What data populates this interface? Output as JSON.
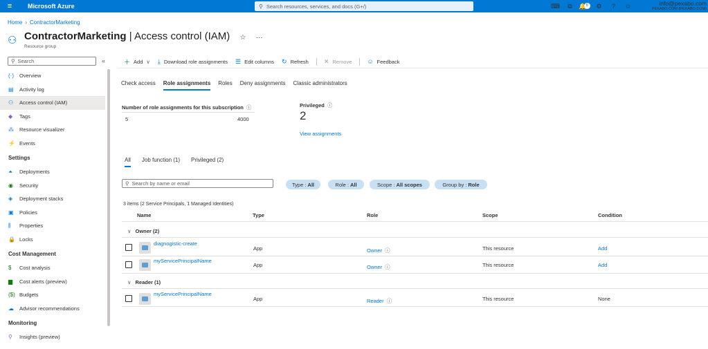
{
  "topbar": {
    "brand": "Microsoft Azure",
    "search_placeholder": "Search resources, services, and docs (G+/)",
    "notification_count": "6",
    "account_email": "info@pexabo.com",
    "account_org": "PEXABO.COM (PEXABO.COM)"
  },
  "breadcrumb": {
    "home": "Home",
    "current": "ContractorMarketing"
  },
  "page": {
    "resource": "ContractorMarketing",
    "separator": " | ",
    "section": "Access control (IAM)",
    "subtitle": "Resource group",
    "star": "☆",
    "more": "···"
  },
  "sidebar": {
    "search_placeholder": "Search",
    "items": [
      {
        "label": "Overview",
        "icon": "(·)",
        "color": "#0078d4"
      },
      {
        "label": "Activity log",
        "icon": "▤",
        "color": "#0078d4"
      },
      {
        "label": "Access control (IAM)",
        "icon": "⚇",
        "color": "#0078d4"
      },
      {
        "label": "Tags",
        "icon": "◆",
        "color": "#8661c5"
      },
      {
        "label": "Resource visualizer",
        "icon": "⁂",
        "color": "#0078d4"
      },
      {
        "label": "Events",
        "icon": "⚡",
        "color": "#ffb900"
      }
    ],
    "settings_header": "Settings",
    "settings_items": [
      {
        "label": "Deployments",
        "icon": "⏶",
        "color": "#0078d4"
      },
      {
        "label": "Security",
        "icon": "◉",
        "color": "#107c10"
      },
      {
        "label": "Deployment stacks",
        "icon": "◈",
        "color": "#0078d4"
      },
      {
        "label": "Policies",
        "icon": "▣",
        "color": "#0078d4"
      },
      {
        "label": "Properties",
        "icon": "⫼",
        "color": "#0078d4"
      },
      {
        "label": "Locks",
        "icon": "🔒",
        "color": "#0078d4"
      }
    ],
    "cost_header": "Cost Management",
    "cost_items": [
      {
        "label": "Cost analysis",
        "icon": "$",
        "color": "#107c10"
      },
      {
        "label": "Cost alerts (preview)",
        "icon": "▆",
        "color": "#107c10"
      },
      {
        "label": "Budgets",
        "icon": "($)",
        "color": "#107c10"
      },
      {
        "label": "Advisor recommendations",
        "icon": "☁",
        "color": "#0078d4"
      }
    ],
    "monitoring_header": "Monitoring",
    "monitoring_items": [
      {
        "label": "Insights (preview)",
        "icon": "⚲",
        "color": "#8661c5"
      }
    ]
  },
  "toolbar": {
    "add": "Add",
    "download": "Download role assignments",
    "edit_columns": "Edit columns",
    "refresh": "Refresh",
    "remove": "Remove",
    "feedback": "Feedback"
  },
  "tabs": [
    "Check access",
    "Role assignments",
    "Roles",
    "Deny assignments",
    "Classic administrators"
  ],
  "stats": {
    "count_label": "Number of role assignments for this subscription",
    "count_value": "5",
    "count_max": "4000",
    "privileged_label": "Privileged",
    "privileged_value": "2",
    "view_link": "View assignments"
  },
  "subtabs": [
    "All",
    "Job function (1)",
    "Privileged (2)"
  ],
  "filters": {
    "search_placeholder": "Search by name or email",
    "type": {
      "key": "Type : ",
      "value": "All"
    },
    "role": {
      "key": "Role : ",
      "value": "All"
    },
    "scope": {
      "key": "Scope : ",
      "value": "All scopes"
    },
    "group": {
      "key": "Group by : ",
      "value": "Role"
    }
  },
  "summary": "3 items (2 Service Principals, 1 Managed Identities)",
  "columns": [
    "Name",
    "Type",
    "Role",
    "Scope",
    "Condition"
  ],
  "groups": [
    {
      "label": "Owner (2)"
    },
    {
      "label": "Reader (1)"
    }
  ],
  "rows": [
    {
      "name": "diagnogistic-create",
      "type": "App",
      "role": "Owner",
      "scope": "This resource",
      "condition": "Add"
    },
    {
      "name": "myServicePrincipalName",
      "type": "App",
      "role": "Owner",
      "scope": "This resource",
      "condition": "Add"
    },
    {
      "name": "myServicePrincipalName",
      "type": "App",
      "role": "Reader",
      "scope": "This resource",
      "condition": "None"
    }
  ]
}
